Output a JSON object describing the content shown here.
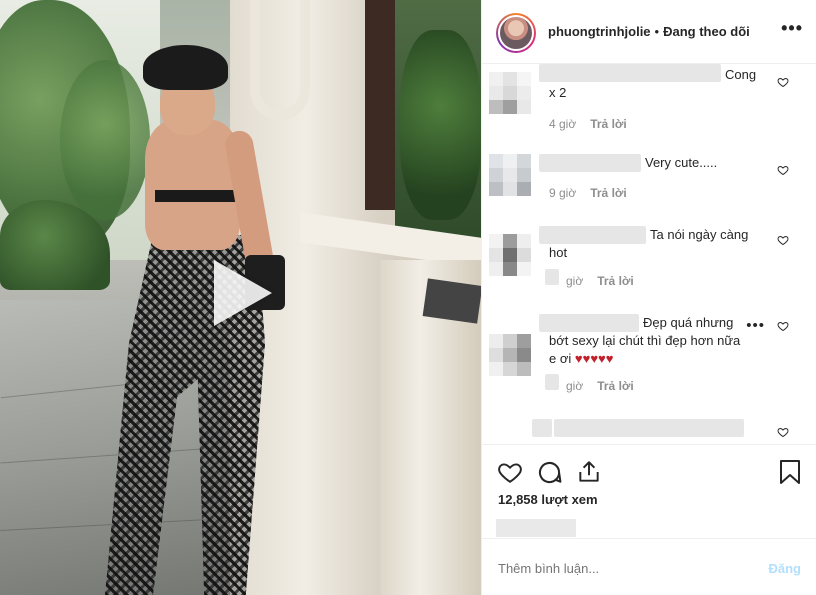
{
  "header": {
    "username": "phuongtrinhjolie",
    "separator": "•",
    "follow_status": "Đang theo dõi",
    "more_label": "•••"
  },
  "comments": [
    {
      "text_line1": "Cong",
      "text_line2": "x 2",
      "time": "4 giờ",
      "reply": "Trả lời"
    },
    {
      "text_line1": "Very cute.....",
      "time": "9 giờ",
      "reply": "Trả lời"
    },
    {
      "text_line1": "Ta nói ngày càng",
      "text_line2": "hot",
      "time": "giờ",
      "reply": "Trả lời"
    },
    {
      "text_line1": "Đẹp quá nhưng",
      "text_line2": "bớt sexy lại chút thì đẹp hơn nữa",
      "text_line3": "e ơi",
      "hearts": "♥♥♥♥♥",
      "time": "giờ",
      "reply": "Trả lời",
      "more": "•••"
    }
  ],
  "actions": {
    "views": "12,858 lượt xem"
  },
  "add_comment": {
    "placeholder": "Thêm bình luận...",
    "post_label": "Đăng"
  },
  "colors": {
    "text": "#262626",
    "muted": "#8e8e8e",
    "post_disabled": "#b2dffc",
    "heart_red": "#c2202b",
    "border": "#efefef"
  },
  "icons": [
    "play-icon",
    "more-icon",
    "heart-outline-icon",
    "comment-icon",
    "share-icon",
    "bookmark-icon"
  ]
}
